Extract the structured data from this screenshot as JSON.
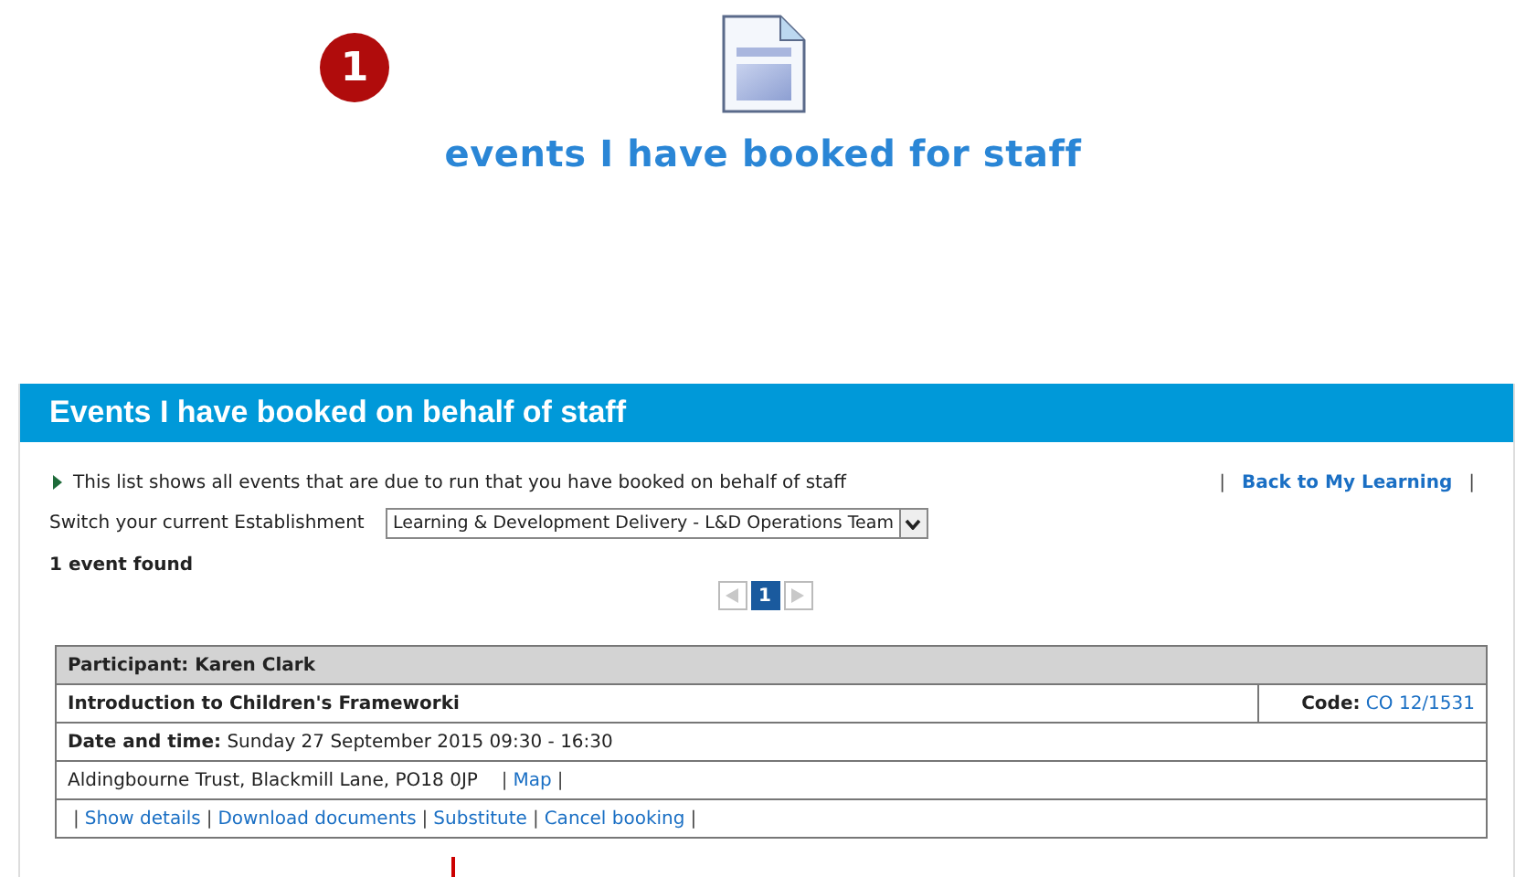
{
  "step_badge": "1",
  "page_title": "events I have booked for staff",
  "panel": {
    "title": "Events I have booked on behalf of staff",
    "intro": "This list shows all events that are due to run that you have booked on behalf of staff",
    "back_link": [
      {
        "kind": "sep",
        "text": "|"
      },
      {
        "kind": "link",
        "text": "Back to My Learning"
      },
      {
        "kind": "sep",
        "text": "|"
      }
    ],
    "establishment": {
      "label": "Switch your current Establishment",
      "value": "Learning & Development Delivery - L&D Operations Team"
    },
    "result_count": "1 event found",
    "pager": [
      {
        "kind": "prev",
        "disabled": true
      },
      {
        "kind": "page",
        "text": "1",
        "selected": true
      },
      {
        "kind": "next",
        "disabled": true
      }
    ],
    "event": {
      "participant": "Participant: Karen Clark",
      "course": "Introduction to Children's Frameworki",
      "code_label": "Code:",
      "code": "CO 12/1531",
      "date_label": "Date and time:",
      "date": "Sunday 27 September 2015 09:30 - 16:30",
      "venue": [
        {
          "kind": "text",
          "text": "Aldingbourne Trust, Blackmill Lane, PO18 0JP"
        },
        {
          "kind": "sep",
          "text": "|"
        },
        {
          "kind": "link",
          "text": "Map"
        },
        {
          "kind": "sep",
          "text": "|"
        }
      ],
      "actions": [
        {
          "kind": "sep",
          "text": "|"
        },
        {
          "kind": "link",
          "text": "Show details"
        },
        {
          "kind": "sep",
          "text": "|"
        },
        {
          "kind": "link",
          "text": "Download documents"
        },
        {
          "kind": "sep",
          "text": "|"
        },
        {
          "kind": "link",
          "text": "Substitute"
        },
        {
          "kind": "sep",
          "text": "|"
        },
        {
          "kind": "link",
          "text": "Cancel booking"
        },
        {
          "kind": "sep",
          "text": "|"
        }
      ]
    }
  }
}
